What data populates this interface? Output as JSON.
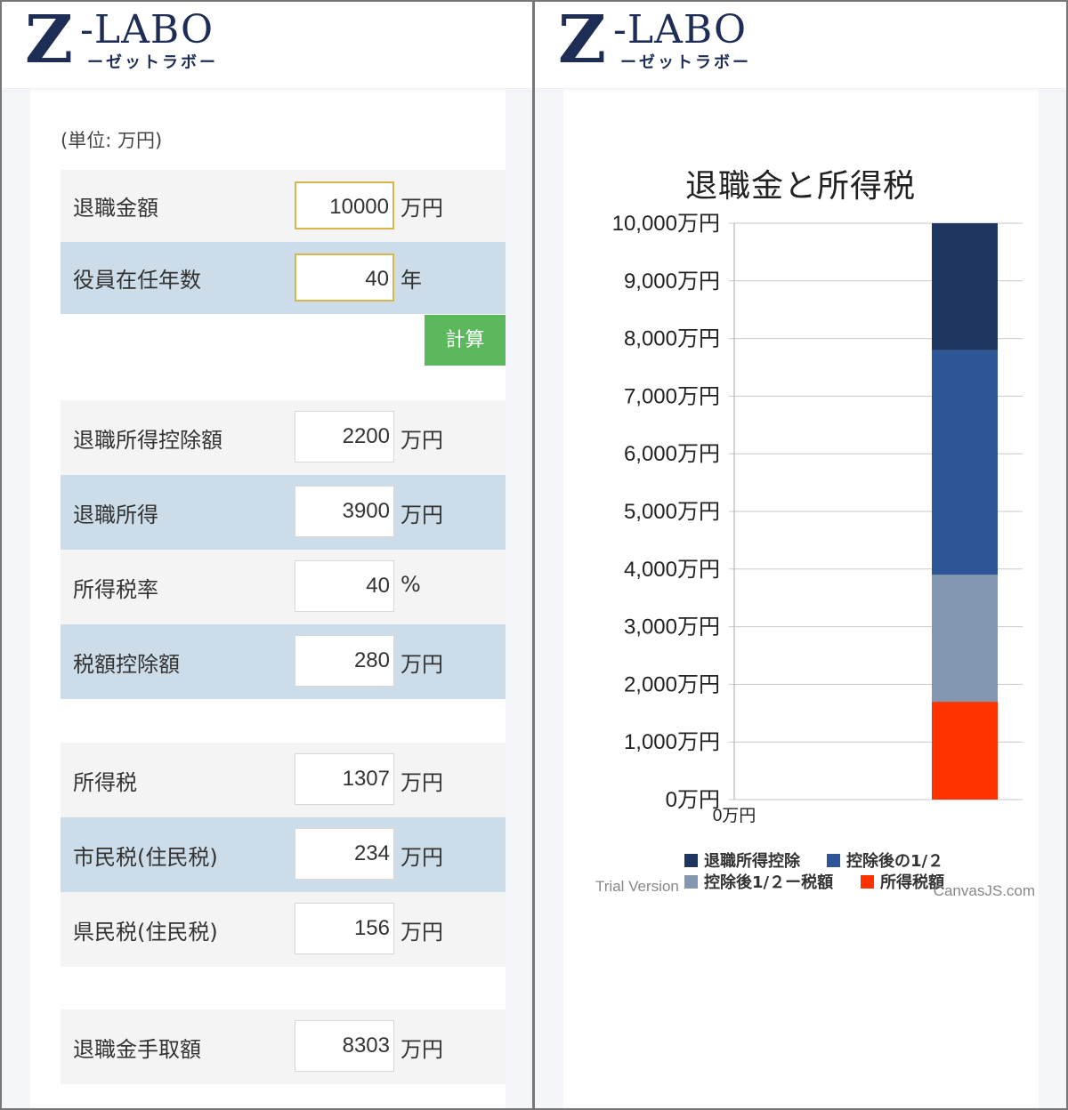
{
  "logo": {
    "main": "Z",
    "labo": "-LABO",
    "sub": "ーゼットラボー"
  },
  "calculator": {
    "unit_note": "(単位: 万円)",
    "inputs": [
      {
        "label": "退職金額",
        "value": "10000",
        "unit": "万円"
      },
      {
        "label": "役員在任年数",
        "value": "40",
        "unit": "年"
      }
    ],
    "calc_button": "計算",
    "results_a": [
      {
        "label": "退職所得控除額",
        "value": "2200",
        "unit": "万円"
      },
      {
        "label": "退職所得",
        "value": "3900",
        "unit": "万円"
      },
      {
        "label": "所得税率",
        "value": "40",
        "unit": "%"
      },
      {
        "label": "税額控除額",
        "value": "280",
        "unit": "万円"
      }
    ],
    "results_b": [
      {
        "label": "所得税",
        "value": "1307",
        "unit": "万円"
      },
      {
        "label": "市民税(住民税)",
        "value": "234",
        "unit": "万円"
      },
      {
        "label": "県民税(住民税)",
        "value": "156",
        "unit": "万円"
      }
    ],
    "net": {
      "label": "退職金手取額",
      "value": "8303",
      "unit": "万円"
    }
  },
  "chart_data": {
    "type": "bar",
    "title": "退職金と所得税",
    "categories": [
      "0万円"
    ],
    "yticks": [
      "0万円",
      "1,000万円",
      "2,000万円",
      "3,000万円",
      "4,000万円",
      "5,000万円",
      "6,000万円",
      "7,000万円",
      "8,000万円",
      "9,000万円",
      "10,000万円"
    ],
    "ylim": [
      0,
      10000
    ],
    "stacked": true,
    "series": [
      {
        "name": "所得税額",
        "color": "#ff3300",
        "values": [
          1697
        ]
      },
      {
        "name": "控除後1/２ー税額",
        "color": "#8497b0",
        "values": [
          2203
        ]
      },
      {
        "name": "控除後の1/２",
        "color": "#2e5596",
        "values": [
          3900
        ]
      },
      {
        "name": "退職所得控除",
        "color": "#1f3660",
        "values": [
          2200
        ]
      }
    ],
    "legend_order": [
      "退職所得控除",
      "控除後の1/２",
      "控除後1/２ー税額",
      "所得税額"
    ],
    "grid": true,
    "credit_left": "Trial Version",
    "credit_right": "CanvasJS.com"
  }
}
